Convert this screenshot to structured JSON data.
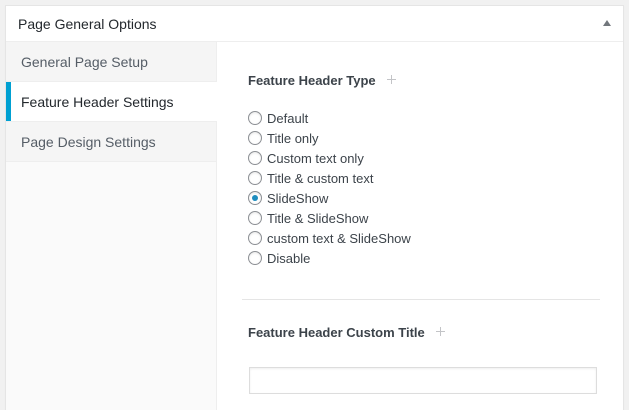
{
  "metabox": {
    "title": "Page General Options"
  },
  "tabs": [
    {
      "label": "General Page Setup",
      "active": false
    },
    {
      "label": "Feature Header Settings",
      "active": true
    },
    {
      "label": "Page Design Settings",
      "active": false
    }
  ],
  "feature_header_type": {
    "label": "Feature Header Type",
    "selected": "SlideShow",
    "options": [
      "Default",
      "Title only",
      "Custom text only",
      "Title & custom text",
      "SlideShow",
      "Title & SlideShow",
      "custom text & SlideShow",
      "Disable"
    ]
  },
  "custom_title": {
    "label": "Feature Header Custom Title",
    "value": "",
    "placeholder": ""
  },
  "colors": {
    "accent": "#00a0d2",
    "radio_checked": "#1e8cbe"
  }
}
